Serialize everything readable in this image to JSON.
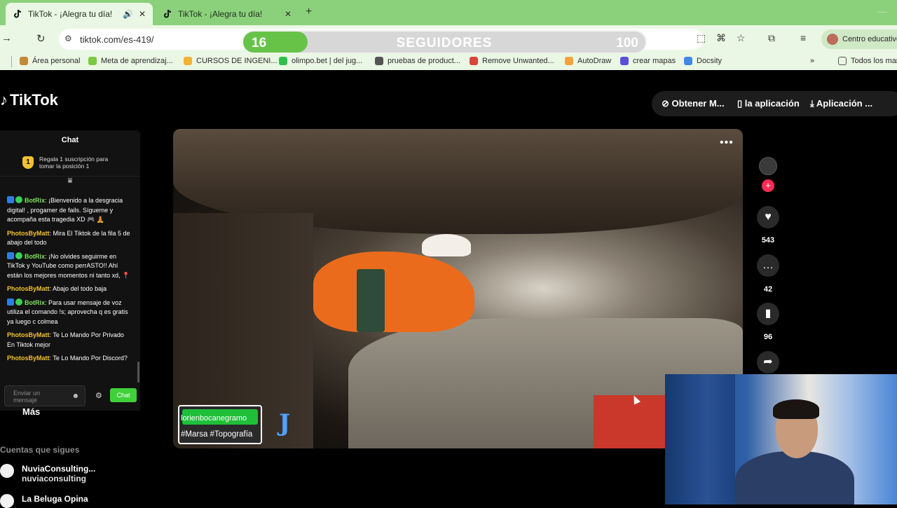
{
  "browser": {
    "tabs": [
      {
        "title": "TikTok - ¡Alegra tu día!",
        "active": true
      },
      {
        "title": "TikTok - ¡Alegra tu día!",
        "active": false
      }
    ],
    "url": "tiktok.com/es-419/",
    "profile_label": "Centro educativo",
    "bookmarks": [
      {
        "label": "Área personal",
        "color": "#c28a3c"
      },
      {
        "label": "Meta de aprendizaj...",
        "color": "#7ac943"
      },
      {
        "label": "CURSOS DE INGENI...",
        "color": "#f2b233"
      },
      {
        "label": "olimpo.bet | del jug...",
        "color": "#2fbf4a"
      },
      {
        "label": "pruebas de product...",
        "color": "#555555"
      },
      {
        "label": "Remove Unwanted...",
        "color": "#d9453b"
      },
      {
        "label": "AutoDraw",
        "color": "#f2a33a"
      },
      {
        "label": "crear mapas",
        "color": "#5b4fd9"
      },
      {
        "label": "Docsity",
        "color": "#3f8ae0"
      }
    ],
    "all_bookmarks_label": "Todos los mar"
  },
  "followers_goal": {
    "current": "16",
    "label": "SEGUIDORES",
    "target": "100",
    "progress": 0.16
  },
  "tiktok": {
    "logo": "TikTok",
    "actions": [
      "Obtener M...",
      "la aplicación",
      "Aplicación ..."
    ]
  },
  "chat": {
    "title": "Chat",
    "gift_rank": "1",
    "gift_text": "Regala 1 suscripción para tomar la posición 1",
    "messages": [
      {
        "user": "BotRix",
        "bot": true,
        "text": "¡Bienvenido a la desgracia digital! , progamer de fails. Sígueme y acompaña esta tragedia XD 🎮 🧘"
      },
      {
        "user": "PhotosByMatt",
        "bot": false,
        "text": "Mira El Tiktok de la fila 5 de abajo del todo"
      },
      {
        "user": "BotRix",
        "bot": true,
        "text": "¡No olvides seguirme en TikTok y YouTube como perrASTO!! Ahí están los mejores momentos ni tanto xd, 📍"
      },
      {
        "user": "PhotosByMatt",
        "bot": false,
        "text": "Abajo del todo baja"
      },
      {
        "user": "BotRix",
        "bot": true,
        "text": "Para usar mensaje de voz utiliza el comando !s; aprovecha q es gratis ya luego c colmea"
      },
      {
        "user": "PhotosByMatt",
        "bot": false,
        "text": "Te Lo Mando Por Privado En Tiktok mejor"
      },
      {
        "user": "PhotosByMatt",
        "bot": false,
        "text": "Te Lo Mando Por Discord?"
      }
    ],
    "input_placeholder": "Enviar un mensaje",
    "send_label": "Chat"
  },
  "sidebar": {
    "more_label": "Más",
    "following_title": "Cuentas que sigues",
    "accounts": [
      {
        "name": "NuviaConsulting...",
        "handle": "nuviaconsulting"
      },
      {
        "name": "La Beluga Opina",
        "handle": ""
      }
    ]
  },
  "video": {
    "tag_user": "lorienbocanegramo",
    "tag_hashtags": "#Marsa #Topografía",
    "overlay_letter": "J"
  },
  "video_actions": {
    "likes": "543",
    "comments": "42",
    "saves": "96"
  }
}
